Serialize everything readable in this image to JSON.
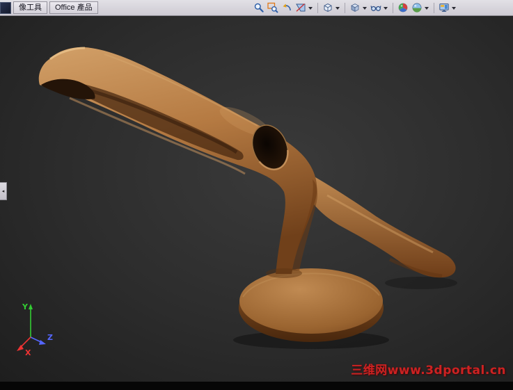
{
  "toolbar": {
    "tabs": [
      {
        "label": "像工具"
      },
      {
        "label": "Office 產品"
      }
    ],
    "icons": [
      {
        "name": "zoom-to-fit"
      },
      {
        "name": "zoom-to-area"
      },
      {
        "name": "previous-view"
      },
      {
        "name": "section-view",
        "dropdown": true
      },
      {
        "name": "view-orientation",
        "dropdown": true
      },
      {
        "name": "display-style",
        "dropdown": true
      },
      {
        "name": "hide-show-items",
        "dropdown": true
      },
      {
        "name": "edit-appearance"
      },
      {
        "name": "apply-scene",
        "dropdown": true
      },
      {
        "name": "view-settings",
        "dropdown": true
      }
    ]
  },
  "viewport": {
    "background_color": "#2e2e2e",
    "model_color": "#b5773f",
    "axes": {
      "x_label": "X",
      "x_color": "#ee3333",
      "y_label": "Y",
      "y_color": "#33cc33",
      "z_label": "Z",
      "z_color": "#5566ff"
    },
    "watermark": {
      "text": "三维网www.3dportal.cn",
      "color": "#cc2222"
    }
  }
}
